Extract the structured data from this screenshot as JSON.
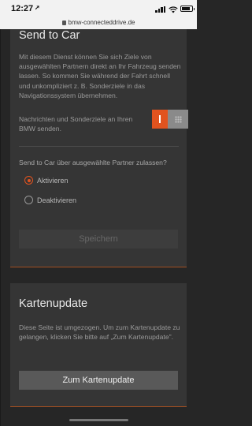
{
  "status_bar": {
    "time": "12:27",
    "location_icon": "location-arrow-icon",
    "signal_icon": "cellular-signal-icon",
    "wifi_icon": "wifi-icon",
    "battery_icon": "battery-icon"
  },
  "url_bar": {
    "url": "bmw-connecteddrive.de",
    "lock_icon": "lock-icon"
  },
  "send_to_car": {
    "title": "Send to Car",
    "description": "Mit diesem Dienst können Sie sich Ziele von ausgewählten Partnern direkt an Ihr Fahrzeug senden lassen. So kommen Sie während der Fahrt schnell und unkompliziert z. B. Sonderziele in das Navigationssystem übernehmen.",
    "toggle_label": "Nachrichten und Sonderziele an Ihren BMW senden.",
    "toggle_state": "on",
    "partner_question": "Send to Car über ausgewählte Partner zulassen?",
    "options": [
      {
        "label": "Aktivieren",
        "checked": true
      },
      {
        "label": "Deaktivieren",
        "checked": false
      }
    ],
    "save_label": "Speichern"
  },
  "map_update": {
    "title": "Kartenupdate",
    "description": "Diese Seite ist umgezogen. Um zum Kartenupdate zu gelangen, klicken Sie bitte auf „Zum Kartenupdate\".",
    "button_label": "Zum Kartenupdate"
  },
  "colors": {
    "accent": "#e1531f",
    "background": "#262626",
    "card": "#353535"
  }
}
